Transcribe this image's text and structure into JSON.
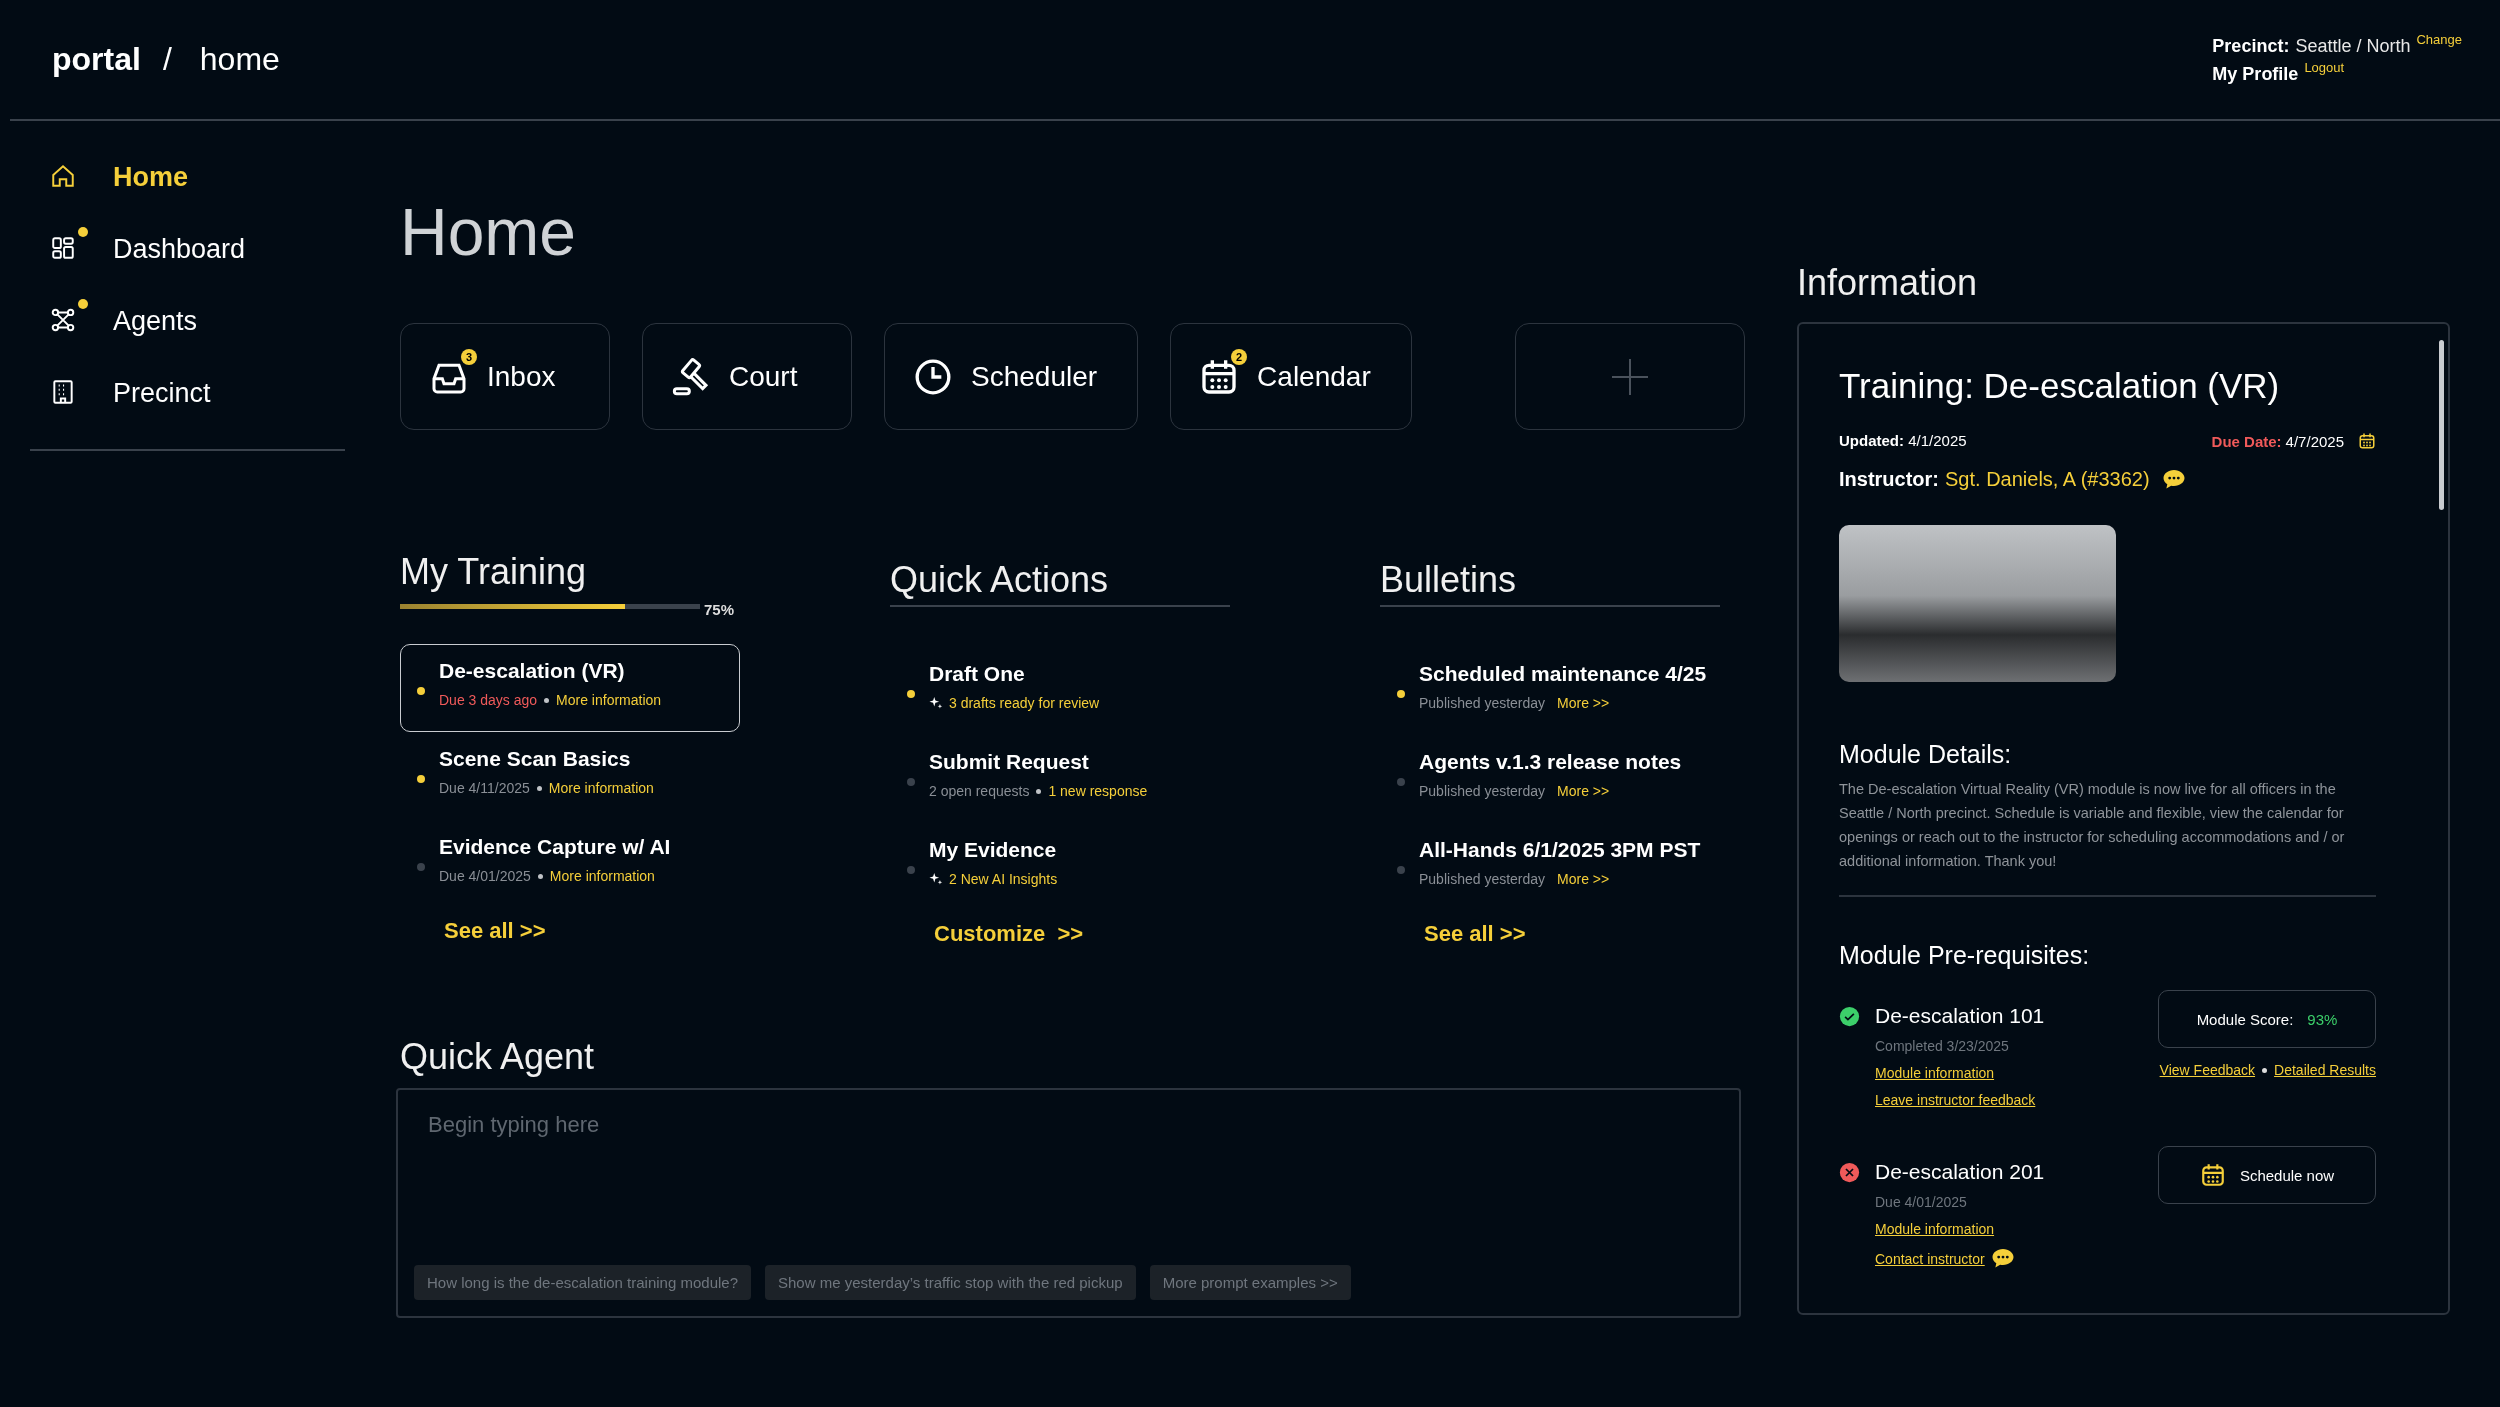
{
  "header": {
    "brand": "portal",
    "separator": "/",
    "page": "home",
    "precinct_label": "Precinct:",
    "precinct_value": "Seattle / North",
    "precinct_action": "Change",
    "profile": "My Profile",
    "profile_action": "Logout"
  },
  "sidebar": {
    "items": [
      {
        "label": "Home",
        "selected": true,
        "notify": false
      },
      {
        "label": "Dashboard",
        "selected": false,
        "notify": true
      },
      {
        "label": "Agents",
        "selected": false,
        "notify": true
      },
      {
        "label": "Precinct",
        "selected": false,
        "notify": false
      }
    ]
  },
  "page_title": "Home",
  "tiles": [
    {
      "label": "Inbox",
      "badge": "3"
    },
    {
      "label": "Court"
    },
    {
      "label": "Scheduler"
    },
    {
      "label": "Calendar",
      "badge": "2"
    }
  ],
  "training": {
    "title": "My Training",
    "level": 0.75,
    "reading": "75%",
    "items": [
      {
        "title": "De-escalation (VR)",
        "selected": true,
        "active": true,
        "due": "Due 3 days ago",
        "overdue": true,
        "link": "More information"
      },
      {
        "title": "Scene Scan Basics",
        "selected": false,
        "active": true,
        "due": "Due 4/11/2025",
        "overdue": false,
        "link": "More information"
      },
      {
        "title": "Evidence Capture w/ AI",
        "selected": false,
        "active": false,
        "due": "Due 4/01/2025",
        "overdue": false,
        "link": "More information"
      }
    ],
    "see_all": "See all >>"
  },
  "quick_actions": {
    "title": "Quick Actions",
    "items": [
      {
        "title": "Draft One",
        "active": true,
        "ai": true,
        "link": "3 drafts ready for review"
      },
      {
        "title": "Submit Request",
        "active": false,
        "ai": false,
        "meta": "2 open requests",
        "link": "1 new response"
      },
      {
        "title": "My Evidence",
        "active": false,
        "ai": true,
        "link": "2 New AI Insights"
      }
    ],
    "customize": "Customize  >>"
  },
  "bulletins": {
    "title": "Bulletins",
    "items": [
      {
        "title": "Scheduled maintenance 4/25",
        "active": true,
        "meta": "Published yesterday",
        "link": "More >>"
      },
      {
        "title": "Agents v.1.3 release notes",
        "active": false,
        "meta": "Published yesterday",
        "link": "More >>"
      },
      {
        "title": "All-Hands 6/1/2025 3PM PST",
        "active": false,
        "meta": "Published yesterday",
        "link": "More >>"
      }
    ],
    "see_all": "See all >>"
  },
  "quick_agent": {
    "title": "Quick Agent",
    "placeholder": "Begin typing here",
    "prompts": [
      "How long is the de-escalation training module?",
      "Show me yesterday’s traffic stop with the red pickup",
      "More prompt examples >>"
    ]
  },
  "information": {
    "title": "Information",
    "card_title": "Training: De-escalation (VR)",
    "updated_label": "Updated:",
    "updated_value": "4/1/2025",
    "due_label": "Due Date:",
    "due_value": "4/7/2025",
    "instructor_label": "Instructor:",
    "instructor_value": "Sgt. Daniels, A (#3362)",
    "details_title": "Module Details:",
    "details_body": "The De-escalation Virtual Reality (VR) module is now live for all officers in the Seattle / North precinct. Schedule is variable and flexible, view the calendar for openings or reach out to the instructor for scheduling accommodations and / or additional information. Thank you!",
    "prereq_title": "Module Pre-requisites:",
    "prereqs": [
      {
        "name": "De-escalation 101",
        "done": true,
        "status": "Completed 3/23/2025",
        "links": [
          "Module information",
          "Leave instructor feedback"
        ],
        "kind": "score",
        "action_label": "Module Score:",
        "action_value": "93%",
        "action_links": [
          "View Feedback",
          "Detailed Results"
        ]
      },
      {
        "name": "De-escalation 201",
        "done": false,
        "status": "Due 4/01/2025",
        "links": [
          "Module information",
          "Contact instructor"
        ],
        "kind": "schedule",
        "action_label": "Schedule now"
      }
    ]
  }
}
